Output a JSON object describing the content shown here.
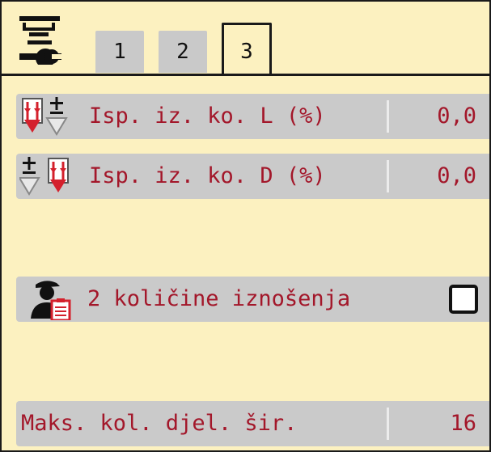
{
  "tabs": [
    {
      "label": "1",
      "active": false
    },
    {
      "label": "2",
      "active": false
    },
    {
      "label": "3",
      "active": true
    }
  ],
  "rows": {
    "left_deviation": {
      "label": "Isp. iz. ko. L (%)",
      "value": "0,0"
    },
    "right_deviation": {
      "label": "Isp. iz. ko. D (%)",
      "value": "0,0"
    },
    "two_quantities": {
      "label": "2 količine iznošenja",
      "checked": false
    },
    "max_sections": {
      "label": "Maks. kol. djel. šir.",
      "value": "16"
    }
  },
  "icons": {
    "settings": "settings-wrench-icon",
    "deviation_left": "arrows-plus-minus-left-icon",
    "deviation_right": "arrows-plus-minus-right-icon",
    "operator": "operator-clipboard-icon"
  },
  "colors": {
    "background": "#fcf1c0",
    "row": "#cacaca",
    "text": "#a3172a",
    "arrow": "#d4202c"
  }
}
